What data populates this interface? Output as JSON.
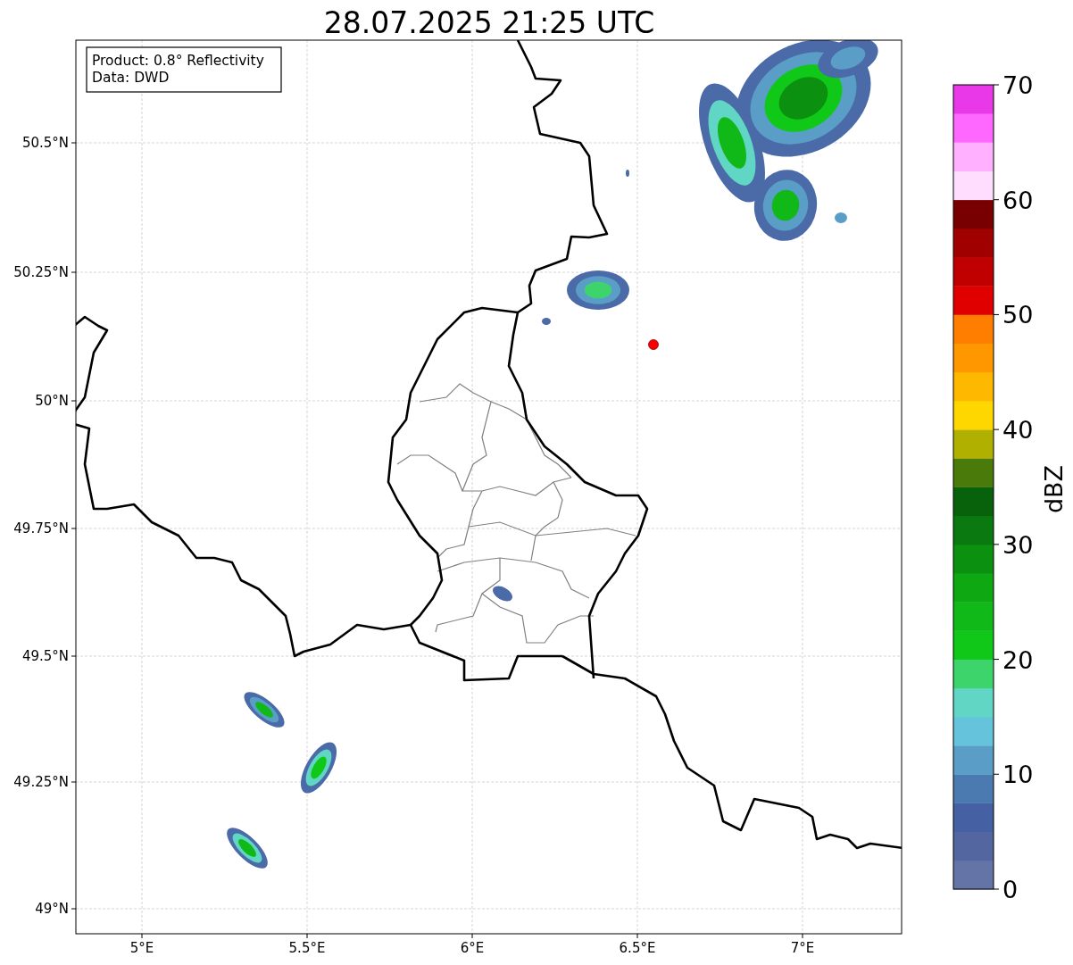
{
  "title": "28.07.2025 21:25 UTC",
  "info_box": [
    "Product: 0.8° Reflectivity",
    "Data: DWD"
  ],
  "x_ticks": [
    "5°E",
    "5.5°E",
    "6°E",
    "6.5°E",
    "7°E"
  ],
  "y_ticks": [
    "50.5°N",
    "50.25°N",
    "50°N",
    "49.75°N",
    "49.5°N",
    "49.25°N",
    "49°N"
  ],
  "colorbar": {
    "label": "dBZ",
    "ticks": [
      "70",
      "60",
      "50",
      "40",
      "30",
      "20",
      "10",
      "0"
    ],
    "segments": [
      {
        "color": "#6574a6"
      },
      {
        "color": "#5366a0"
      },
      {
        "color": "#4560a3"
      },
      {
        "color": "#4a7ab0"
      },
      {
        "color": "#5a9ec8"
      },
      {
        "color": "#66c3dc"
      },
      {
        "color": "#62d6c5"
      },
      {
        "color": "#3ed46c"
      },
      {
        "color": "#10c818"
      },
      {
        "color": "#10b818"
      },
      {
        "color": "#0ea812"
      },
      {
        "color": "#0c9010"
      },
      {
        "color": "#0a7a10"
      },
      {
        "color": "#08620c"
      },
      {
        "color": "#4a7a0a"
      },
      {
        "color": "#b0b000"
      },
      {
        "color": "#ffd700"
      },
      {
        "color": "#ffb800"
      },
      {
        "color": "#ff9800"
      },
      {
        "color": "#ff7e00"
      },
      {
        "color": "#e00000"
      },
      {
        "color": "#c00000"
      },
      {
        "color": "#a00000"
      },
      {
        "color": "#780000"
      },
      {
        "color": "#ffddff"
      },
      {
        "color": "#ffb0ff"
      },
      {
        "color": "#ff68ff"
      },
      {
        "color": "#e838e8"
      }
    ]
  }
}
